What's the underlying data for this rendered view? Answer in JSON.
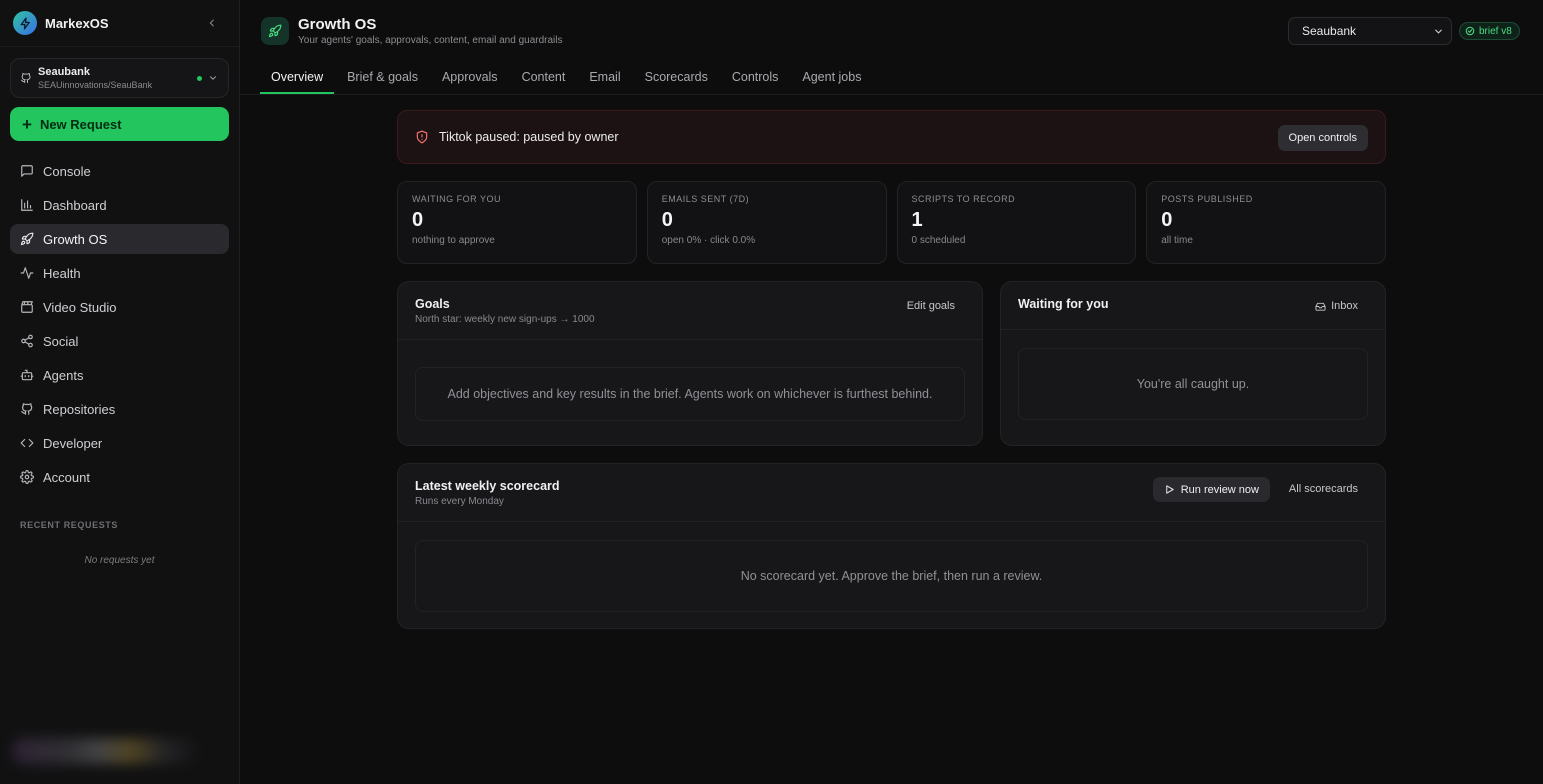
{
  "app": {
    "name": "MarkexOS"
  },
  "workspace": {
    "name": "Seaubank",
    "path": "SEAUinnovations/SeauBank"
  },
  "sidebar": {
    "new_request": "New Request",
    "items": [
      {
        "label": "Console",
        "icon": "message-square-icon"
      },
      {
        "label": "Dashboard",
        "icon": "bar-chart-icon"
      },
      {
        "label": "Growth OS",
        "icon": "rocket-icon",
        "active": true
      },
      {
        "label": "Health",
        "icon": "activity-icon"
      },
      {
        "label": "Video Studio",
        "icon": "clapperboard-icon"
      },
      {
        "label": "Social",
        "icon": "share-icon"
      },
      {
        "label": "Agents",
        "icon": "bot-icon"
      },
      {
        "label": "Repositories",
        "icon": "github-icon"
      },
      {
        "label": "Developer",
        "icon": "code-icon"
      },
      {
        "label": "Account",
        "icon": "gear-icon"
      }
    ],
    "recent_title": "RECENT REQUESTS",
    "recent_empty": "No requests yet"
  },
  "header": {
    "title": "Growth OS",
    "subtitle": "Your agents' goals, approvals, content, email and guardrails",
    "workspace_select": "Seaubank",
    "brief_badge": "brief v8"
  },
  "tabs": [
    "Overview",
    "Brief & goals",
    "Approvals",
    "Content",
    "Email",
    "Scorecards",
    "Controls",
    "Agent jobs"
  ],
  "alert": {
    "text": "Tiktok paused: paused by owner",
    "button": "Open controls"
  },
  "stats": [
    {
      "label": "WAITING FOR YOU",
      "value": "0",
      "sub": "nothing to approve"
    },
    {
      "label": "EMAILS SENT (7D)",
      "value": "0",
      "sub": "open 0% · click 0.0%"
    },
    {
      "label": "SCRIPTS TO RECORD",
      "value": "1",
      "sub": "0 scheduled"
    },
    {
      "label": "POSTS PUBLISHED",
      "value": "0",
      "sub": "all time"
    }
  ],
  "goals": {
    "title": "Goals",
    "subtitle": "North star: weekly new sign-ups → 1000",
    "edit": "Edit goals",
    "empty": "Add objectives and key results in the brief. Agents work on whichever is furthest behind."
  },
  "waiting": {
    "title": "Waiting for you",
    "inbox": "Inbox",
    "empty": "You're all caught up."
  },
  "scorecard": {
    "title": "Latest weekly scorecard",
    "subtitle": "Runs every Monday",
    "run": "Run review now",
    "all": "All scorecards",
    "empty": "No scorecard yet. Approve the brief, then run a review."
  },
  "colors": {
    "accent": "#22c55e",
    "alert_bg": "#1c1213",
    "background": "#0d0d0e"
  }
}
